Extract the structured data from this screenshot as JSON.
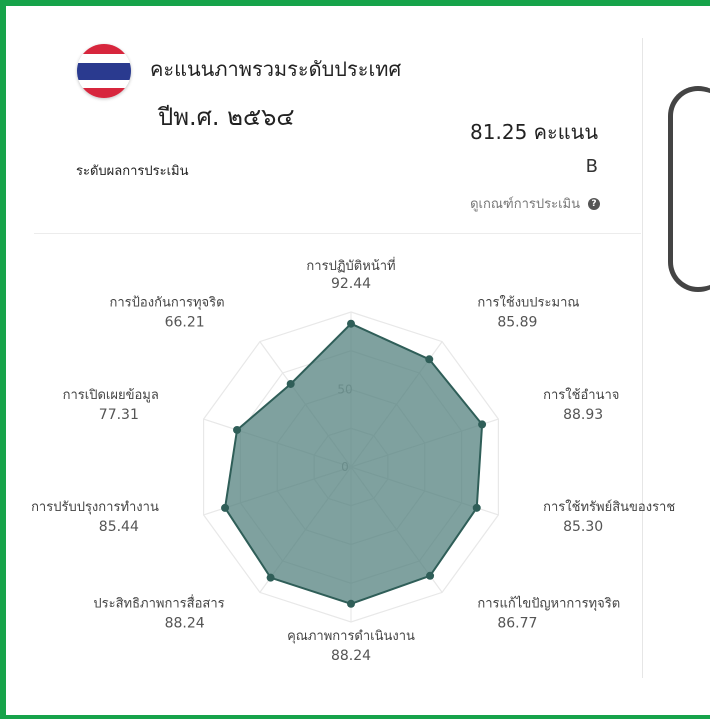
{
  "header": {
    "title": "คะแนนภาพรวมระดับประเทศ",
    "year": "ปีพ.ศ. ๒๕๖๔",
    "score": "81.25 คะแนน",
    "level_label": "ระดับผลการประเมิน",
    "grade": "B",
    "criteria_link": "ดูเกณฑ์การประเมิน",
    "help_icon": "question-circle-icon",
    "flag_icon": "thailand-flag-icon"
  },
  "colors": {
    "frame": "#16a34a",
    "fill": "#4e7d7a",
    "stroke": "#2f5e58",
    "grid": "#e8e8e8"
  },
  "chart_data": {
    "type": "radar",
    "title": "",
    "ylim": [
      0,
      100
    ],
    "radial_ticks": [
      0,
      50
    ],
    "grid": "decagon",
    "categories": [
      "การปฏิบัติหน้าที่",
      "การใช้งบประมาณ",
      "การใช้อำนาจ",
      "การใช้ทรัพย์สินของราช",
      "การแก้ไขปัญหาการทุจริต",
      "คุณภาพการดำเนินงาน",
      "ประสิทธิภาพการสื่อสาร",
      "การปรับปรุงการทำงาน",
      "การเปิดเผยข้อมูล",
      "การป้องกันการทุจริต"
    ],
    "series": [
      {
        "values": [
          92.44,
          85.89,
          88.93,
          85.3,
          86.77,
          88.24,
          88.24,
          85.44,
          77.31,
          66.21
        ]
      }
    ],
    "value_labels": [
      "92.44",
      "85.89",
      "88.93",
      "85.30",
      "86.77",
      "88.24",
      "88.24",
      "85.44",
      "77.31",
      "66.21"
    ]
  }
}
